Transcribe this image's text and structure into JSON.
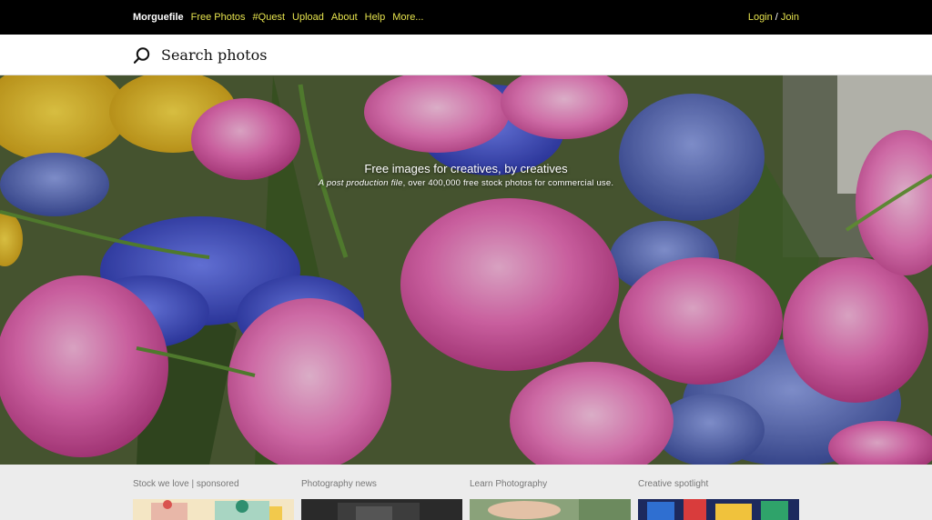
{
  "nav": {
    "brand": "Morguefile",
    "items": [
      "Free Photos",
      "#Quest",
      "Upload",
      "About",
      "Help",
      "More..."
    ],
    "login": "Login",
    "separator": "/",
    "join": "Join"
  },
  "search": {
    "placeholder": "Search photos"
  },
  "hero": {
    "title": "Free images for creatives, by creatives",
    "subtitle_em": "A post production file",
    "subtitle_rest": ", over 400,000 free stock photos for commercial use."
  },
  "cards": [
    {
      "label": "Stock we love | sponsored"
    },
    {
      "label": "Photography news"
    },
    {
      "label": "Learn Photography"
    },
    {
      "label": "Creative spotlight"
    }
  ],
  "colors": {
    "nav_link": "#e6e34e",
    "topbar_bg": "#000000",
    "page_bg": "#ececec"
  }
}
